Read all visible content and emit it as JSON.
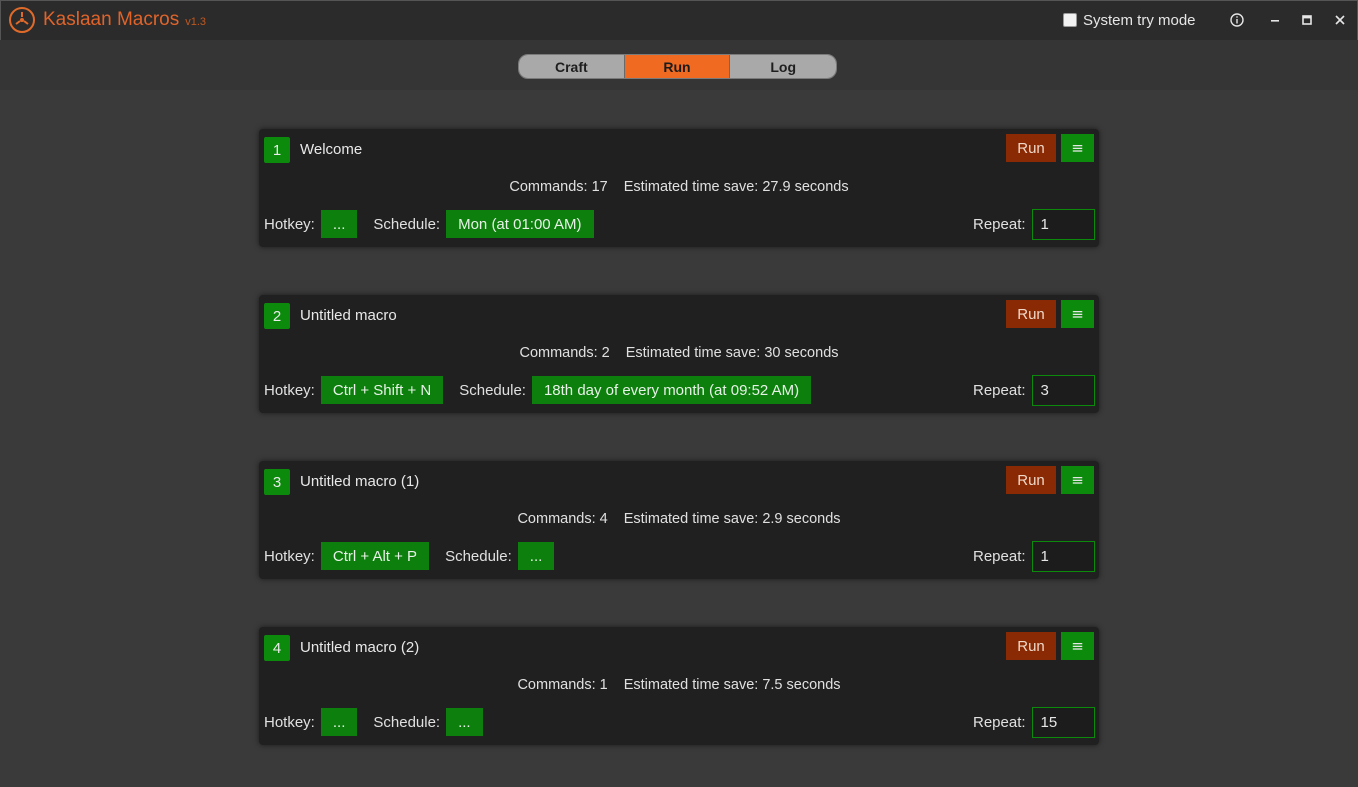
{
  "app": {
    "title": "Kaslaan Macros",
    "version": "v1.3",
    "tray_label": "System try mode",
    "tray_checked": false
  },
  "tabs": [
    {
      "label": "Craft",
      "active": false
    },
    {
      "label": "Run",
      "active": true
    },
    {
      "label": "Log",
      "active": false
    }
  ],
  "labels": {
    "hotkey": "Hotkey:",
    "schedule": "Schedule:",
    "repeat": "Repeat:",
    "run": "Run",
    "menu": "≡"
  },
  "macros": [
    {
      "number": "1",
      "name": "Welcome",
      "commands": "Commands: 17",
      "time_save": "Estimated time save: 27.9 seconds",
      "hotkey": "...",
      "schedule": "Mon (at 01:00 AM)",
      "repeat": "1"
    },
    {
      "number": "2",
      "name": "Untitled macro",
      "commands": "Commands: 2",
      "time_save": "Estimated time save: 30 seconds",
      "hotkey": "Ctrl + Shift + N",
      "schedule": "18th day of every month (at 09:52 AM)",
      "repeat": "3"
    },
    {
      "number": "3",
      "name": "Untitled macro (1)",
      "commands": "Commands: 4",
      "time_save": "Estimated time save: 2.9 seconds",
      "hotkey": "Ctrl + Alt + P",
      "schedule": "...",
      "repeat": "1"
    },
    {
      "number": "4",
      "name": "Untitled macro (2)",
      "commands": "Commands: 1",
      "time_save": "Estimated time save: 7.5 seconds",
      "hotkey": "...",
      "schedule": "...",
      "repeat": "15"
    }
  ],
  "colors": {
    "accent_orange": "#f06a22",
    "run_button": "#8a2a05",
    "green": "#0c8a0c"
  }
}
